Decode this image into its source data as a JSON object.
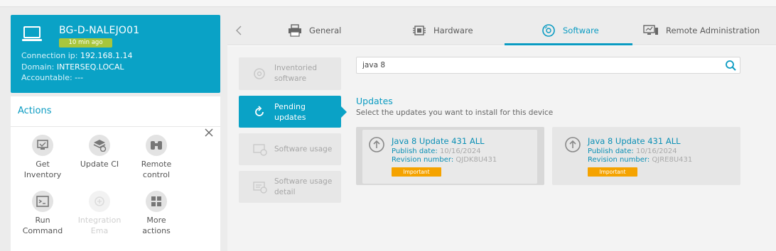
{
  "device": {
    "name": "BG-D-NALEJO01",
    "last_seen": "10 min ago",
    "connection_ip_label": "Connection ip:",
    "connection_ip": "192.168.1.14",
    "domain_label": "Domain:",
    "domain": "INTERSEQ.LOCAL",
    "accountable_label": "Accountable:",
    "accountable": "---"
  },
  "actions": {
    "title": "Actions",
    "items": [
      {
        "line1": "Get",
        "line2": "Inventory",
        "icon": "get-inventory-icon",
        "enabled": true
      },
      {
        "line1": "Update CI",
        "line2": "",
        "icon": "update-ci-icon",
        "enabled": true
      },
      {
        "line1": "Remote",
        "line2": "control",
        "icon": "binoculars-icon",
        "enabled": true
      },
      {
        "line1": "Run",
        "line2": "Command",
        "icon": "terminal-icon",
        "enabled": true
      },
      {
        "line1": "Integration",
        "line2": "Ema",
        "icon": "integration-icon",
        "enabled": false
      },
      {
        "line1": "More",
        "line2": "actions",
        "icon": "more-actions-icon",
        "enabled": true
      }
    ]
  },
  "tabs": [
    {
      "label": "General",
      "icon": "printer-icon",
      "active": false
    },
    {
      "label": "Hardware",
      "icon": "chip-icon",
      "active": false
    },
    {
      "label": "Software",
      "icon": "disc-icon",
      "active": true
    },
    {
      "label": "Remote Administration",
      "icon": "remote-admin-icon",
      "active": false
    }
  ],
  "side_menu": [
    {
      "label": "Inventoried software",
      "active": false
    },
    {
      "label": "Pending updates",
      "active": true
    },
    {
      "label": "Software usage",
      "active": false
    },
    {
      "label": "Software usage detail",
      "active": false
    }
  ],
  "search": {
    "value": "java 8"
  },
  "updates": {
    "title": "Updates",
    "subtitle": "Select the updates you want to install for this device",
    "publish_label": "Publish date:",
    "revision_label": "Revision number:",
    "cards": [
      {
        "name": "Java 8 Update 431 ALL",
        "publish_date": "10/16/2024",
        "revision": "QJDK8U431",
        "badge": "Important",
        "selected": true
      },
      {
        "name": "Java 8 Update 431 ALL",
        "publish_date": "10/16/2024",
        "revision": "QJRE8U431",
        "badge": "Important",
        "selected": false
      }
    ]
  },
  "colors": {
    "accent": "#0aa2c6",
    "badge_green": "#a8c63c",
    "important": "#f5a300"
  }
}
